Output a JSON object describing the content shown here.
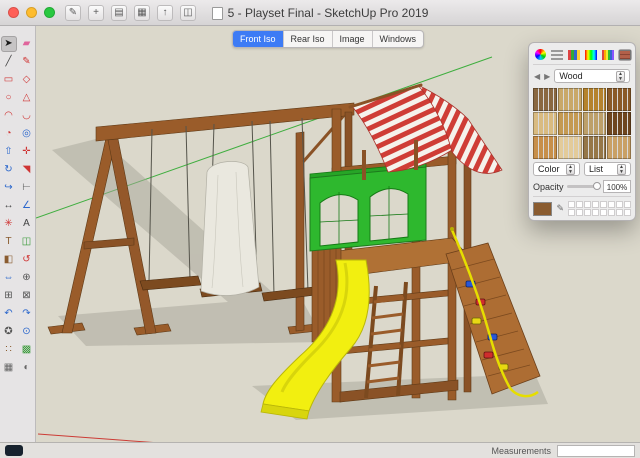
{
  "window": {
    "title": "5 - Playset Final - SketchUp Pro 2019"
  },
  "titlebar": {
    "tools": [
      {
        "name": "edit",
        "glyph": "✎"
      },
      {
        "name": "add",
        "glyph": "+"
      },
      {
        "name": "layers",
        "glyph": "▤"
      },
      {
        "name": "panels",
        "glyph": "▦"
      },
      {
        "name": "share",
        "glyph": "↑"
      },
      {
        "name": "windows",
        "glyph": "◫"
      }
    ]
  },
  "scene_tabs": [
    {
      "label": "Front Iso",
      "active": true
    },
    {
      "label": "Rear Iso",
      "active": false
    },
    {
      "label": "Image",
      "active": false
    },
    {
      "label": "Windows",
      "active": false
    }
  ],
  "tools": [
    {
      "name": "select",
      "glyph": "➤",
      "color": "#1a1a1a"
    },
    {
      "name": "eraser",
      "glyph": "▰",
      "color": "#e0659c"
    },
    {
      "name": "line",
      "glyph": "╱",
      "color": "#444444"
    },
    {
      "name": "freehand",
      "glyph": "✎",
      "color": "#cf3434"
    },
    {
      "name": "rectangle",
      "glyph": "▭",
      "color": "#cf3434"
    },
    {
      "name": "rotated-rectangle",
      "glyph": "◇",
      "color": "#cf3434"
    },
    {
      "name": "circle",
      "glyph": "○",
      "color": "#cf3434"
    },
    {
      "name": "polygon",
      "glyph": "△",
      "color": "#cf3434"
    },
    {
      "name": "arc",
      "glyph": "◠",
      "color": "#cf3434"
    },
    {
      "name": "two-point-arc",
      "glyph": "◡",
      "color": "#cf3434"
    },
    {
      "name": "pie",
      "glyph": "◔",
      "color": "#cf3434"
    },
    {
      "name": "offset",
      "glyph": "◎",
      "color": "#2a66cc"
    },
    {
      "name": "push-pull",
      "glyph": "⇧",
      "color": "#2a66cc"
    },
    {
      "name": "move",
      "glyph": "✛",
      "color": "#cf3434"
    },
    {
      "name": "rotate",
      "glyph": "↻",
      "color": "#2a66cc"
    },
    {
      "name": "scale",
      "glyph": "◥",
      "color": "#cf3434"
    },
    {
      "name": "follow-me",
      "glyph": "↪",
      "color": "#2a66cc"
    },
    {
      "name": "tape-measure",
      "glyph": "⊢",
      "color": "#666666"
    },
    {
      "name": "dimensions",
      "glyph": "↔",
      "color": "#444444"
    },
    {
      "name": "protractor",
      "glyph": "∠",
      "color": "#2a66cc"
    },
    {
      "name": "axes",
      "glyph": "✳",
      "color": "#cf3434"
    },
    {
      "name": "text",
      "glyph": "A",
      "color": "#444444"
    },
    {
      "name": "3d-text",
      "glyph": "T",
      "color": "#8a5c30"
    },
    {
      "name": "section-plane",
      "glyph": "◫",
      "color": "#3a9a3a"
    },
    {
      "name": "paint-bucket",
      "glyph": "◧",
      "color": "#8a5c30"
    },
    {
      "name": "orbit",
      "glyph": "↺",
      "color": "#cf3434"
    },
    {
      "name": "pan",
      "glyph": "⇔",
      "color": "#2a66cc"
    },
    {
      "name": "zoom",
      "glyph": "⊕",
      "color": "#555555"
    },
    {
      "name": "zoom-window",
      "glyph": "⊞",
      "color": "#555555"
    },
    {
      "name": "zoom-extents",
      "glyph": "⊠",
      "color": "#555555"
    },
    {
      "name": "previous-view",
      "glyph": "↶",
      "color": "#2a66cc"
    },
    {
      "name": "next-view",
      "glyph": "↷",
      "color": "#2a66cc"
    },
    {
      "name": "position-camera",
      "glyph": "✪",
      "color": "#555555"
    },
    {
      "name": "look-around",
      "glyph": "⊙",
      "color": "#2a66cc"
    },
    {
      "name": "walk",
      "glyph": "∷",
      "color": "#8a5c30"
    },
    {
      "name": "section-fill",
      "glyph": "▩",
      "color": "#3a9a3a"
    },
    {
      "name": "x-ray",
      "glyph": "▦",
      "color": "#666666"
    },
    {
      "name": "shadows",
      "glyph": "◐",
      "color": "#666666"
    }
  ],
  "materials_panel": {
    "tabs": [
      {
        "name": "color-wheel",
        "active": false
      },
      {
        "name": "color-sliders",
        "active": false
      },
      {
        "name": "color-palettes",
        "active": false
      },
      {
        "name": "image-palettes",
        "active": false
      },
      {
        "name": "crayons",
        "active": false
      },
      {
        "name": "textures",
        "active": true
      }
    ],
    "nav_back": "◀",
    "nav_forward": "▶",
    "collection_dropdown": "Wood",
    "swatches": [
      "#8a6840",
      "#c9a869",
      "#b5832d",
      "#8a5a28",
      "#d9bb80",
      "#c49a52",
      "#bda06a",
      "#6e451e",
      "#c78f4a",
      "#e3cb9a",
      "#967748",
      "#c9a065"
    ],
    "color_dropdown": "Color",
    "list_dropdown": "List",
    "opacity_label": "Opacity",
    "opacity_value": "100%",
    "active_material_color": "#8a5c30",
    "mini_swatch_count": 16
  },
  "status_bar": {
    "measurements_label": "Measurements",
    "measurements_value": ""
  },
  "colors": {
    "accent_blue": "#3d7bf5",
    "canvas_bg": "#dbd8cb",
    "wood": "#9a5c2a",
    "slide_yellow": "#f2ef10",
    "panel_green": "#2eb82e",
    "canopy_red": "#cf3d36"
  }
}
